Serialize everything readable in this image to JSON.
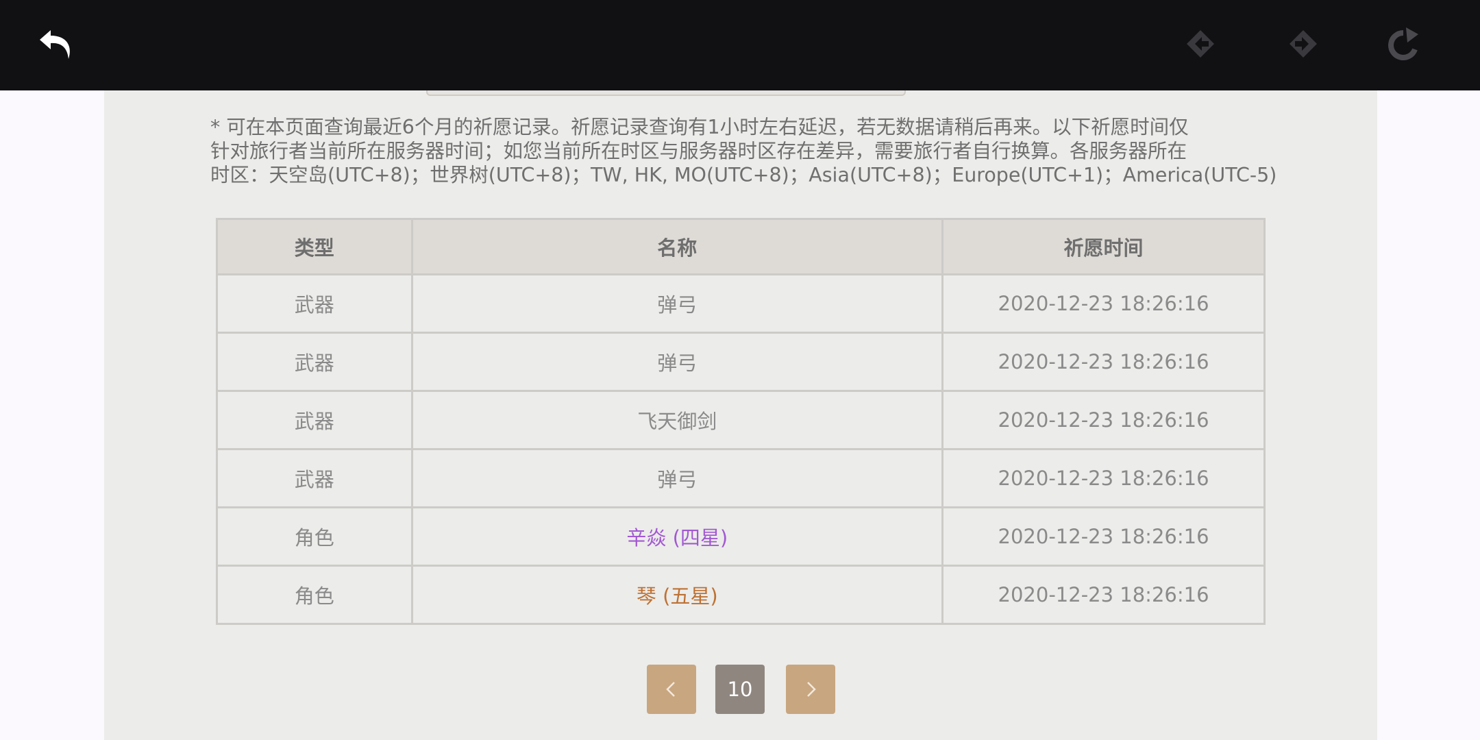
{
  "topbar": {
    "icons": [
      "back-arrow-icon",
      "prev-diamond-icon",
      "next-diamond-icon",
      "refresh-icon"
    ]
  },
  "notice": {
    "lines": [
      "* 可在本页面查询最近6个月的祈愿记录。祈愿记录查询有1小时左右延迟，若无数据请稍后再来。以下祈愿时间仅",
      "针对旅行者当前所在服务器时间；如您当前所在时区与服务器时区存在差异，需要旅行者自行换算。各服务器所在",
      "时区：天空岛(UTC+8)；世界树(UTC+8)；TW, HK, MO(UTC+8)；Asia(UTC+8)；Europe(UTC+1)；America(UTC-5)"
    ]
  },
  "table": {
    "headers": [
      "类型",
      "名称",
      "祈愿时间"
    ],
    "rows": [
      {
        "type": "武器",
        "name": "弹弓",
        "time": "2020-12-23 18:26:16"
      },
      {
        "type": "武器",
        "name": "弹弓",
        "time": "2020-12-23 18:26:16"
      },
      {
        "type": "武器",
        "name": "飞天御剑",
        "time": "2020-12-23 18:26:16"
      },
      {
        "type": "武器",
        "name": "弹弓",
        "time": "2020-12-23 18:26:16"
      },
      {
        "type": "角色",
        "name": "辛焱 (四星)",
        "time": "2020-12-23 18:26:16"
      },
      {
        "type": "角色",
        "name": "琴 (五星)",
        "time": "2020-12-23 18:26:16"
      }
    ]
  },
  "pager": {
    "prev_label": "<",
    "page": "10",
    "next_label": ">"
  },
  "colors": {
    "four_star": "#a258d3",
    "five_star": "#bd7134",
    "pager_button": "#c8a680",
    "pager_current": "#8f8680"
  }
}
